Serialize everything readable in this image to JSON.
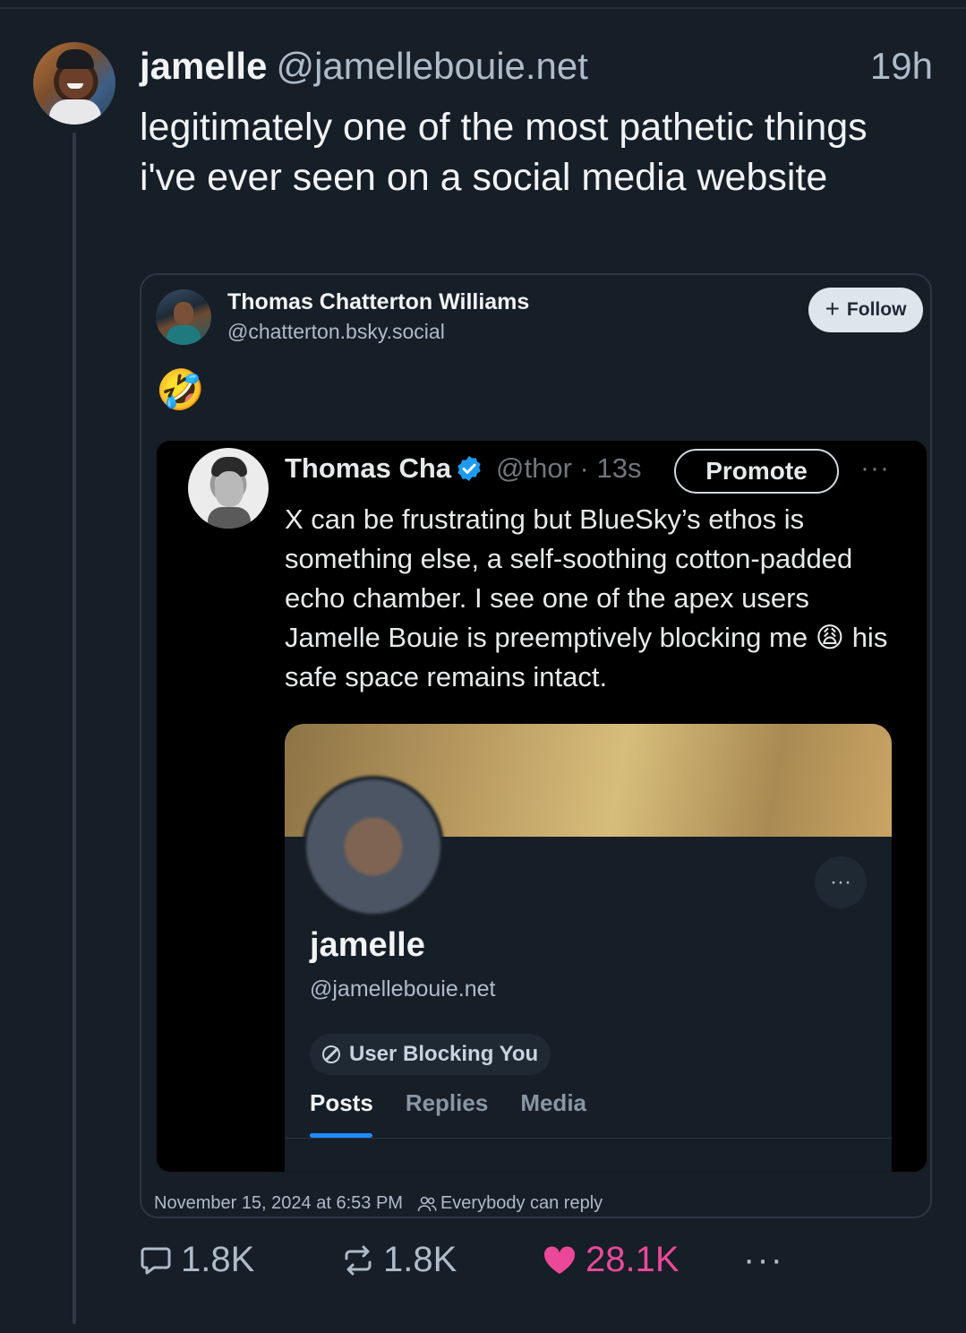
{
  "post": {
    "display_name": "jamelle",
    "handle": "@jamellebouie.net",
    "time": "19h",
    "text": "legitimately one of the most pathetic things i've ever seen on a social media website"
  },
  "quote": {
    "display_name": "Thomas Chatterton Williams",
    "handle": "@chatterton.bsky.social",
    "follow_label": "Follow",
    "emoji": "🤣",
    "timestamp": "November 15, 2024 at 6:53 PM",
    "reply_setting": "Everybody can reply"
  },
  "screenshot": {
    "name": "Thomas Cha",
    "handle_time": "@thor · 13s",
    "promote_label": "Promote",
    "more": "···",
    "text_before_emoji": "X can be frustrating but BlueSky’s ethos is something else, a self-soothing cotton-padded echo chamber. I see one of the apex users Jamelle Bouie is preemptively blocking me",
    "emoji": "😩",
    "text_after_emoji": "his safe space remains intact.",
    "profile": {
      "name": "jamelle",
      "handle": "@jamellebouie.net",
      "more": "···",
      "blocking_label": "User Blocking You",
      "tabs": [
        "Posts",
        "Replies",
        "Media"
      ],
      "active_tab": "Posts"
    }
  },
  "actions": {
    "replies": "1.8K",
    "reposts": "1.8K",
    "likes": "28.1K",
    "more": "···"
  },
  "colors": {
    "background": "#161e27",
    "like_pink": "#ec4899",
    "verified_blue": "#1d9bf0",
    "tab_underline": "#208bfe"
  }
}
